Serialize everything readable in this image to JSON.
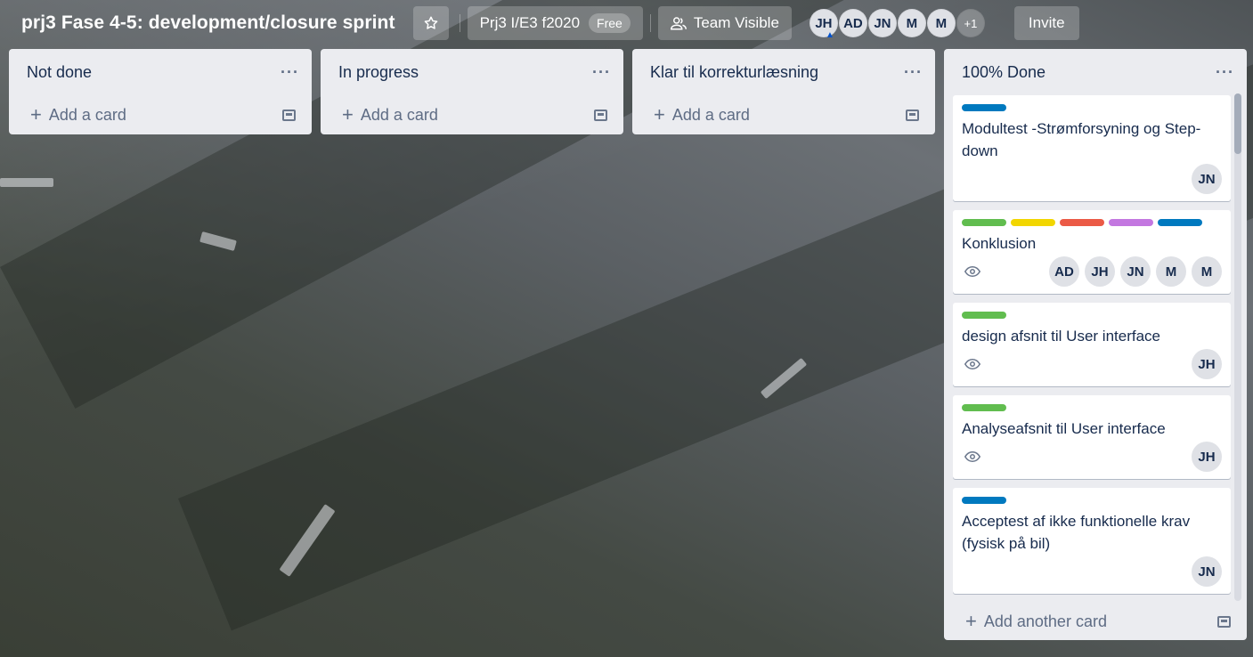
{
  "board": {
    "title": "prj3 Fase 4-5: development/closure sprint",
    "workspace": "Prj3 I/E3 f2020",
    "plan_badge": "Free",
    "visibility": "Team Visible",
    "members": [
      "JH",
      "AD",
      "JN",
      "M",
      "M"
    ],
    "more_members": "+1",
    "invite": "Invite"
  },
  "lists": [
    {
      "title": "Not done",
      "add_label": "Add a card"
    },
    {
      "title": "In progress",
      "add_label": "Add a card"
    },
    {
      "title": "Klar til korrekturlæsning",
      "add_label": "Add a card"
    },
    {
      "title": "100% Done",
      "add_label": "Add another card",
      "cards": [
        {
          "title": "Modultest -Strømforsyning og Step-down",
          "labels": [
            "#0079bf"
          ],
          "members": [
            "JN"
          ],
          "watching": false
        },
        {
          "title": "Konklusion",
          "labels": [
            "#61bd4f",
            "#f2d600",
            "#eb5a46",
            "#c377e0",
            "#0079bf"
          ],
          "members": [
            "AD",
            "JH",
            "JN",
            "M",
            "M"
          ],
          "watching": true
        },
        {
          "title": "design afsnit til User interface",
          "labels": [
            "#61bd4f"
          ],
          "members": [
            "JH"
          ],
          "watching": true
        },
        {
          "title": "Analyseafsnit til User interface",
          "labels": [
            "#61bd4f"
          ],
          "members": [
            "JH"
          ],
          "watching": true
        },
        {
          "title": "Acceptest af ikke funktionelle krav (fysisk på bil)",
          "labels": [
            "#0079bf"
          ],
          "members": [
            "JN"
          ],
          "watching": false
        }
      ]
    }
  ],
  "icons": {
    "star": "star-icon",
    "visibility": "team-icon",
    "list_menu": "more-horizontal-icon",
    "add": "plus-icon",
    "template": "card-template-icon",
    "watch": "eye-icon",
    "admin": "admin-chevron-icon"
  },
  "list_menu_glyph": "···"
}
